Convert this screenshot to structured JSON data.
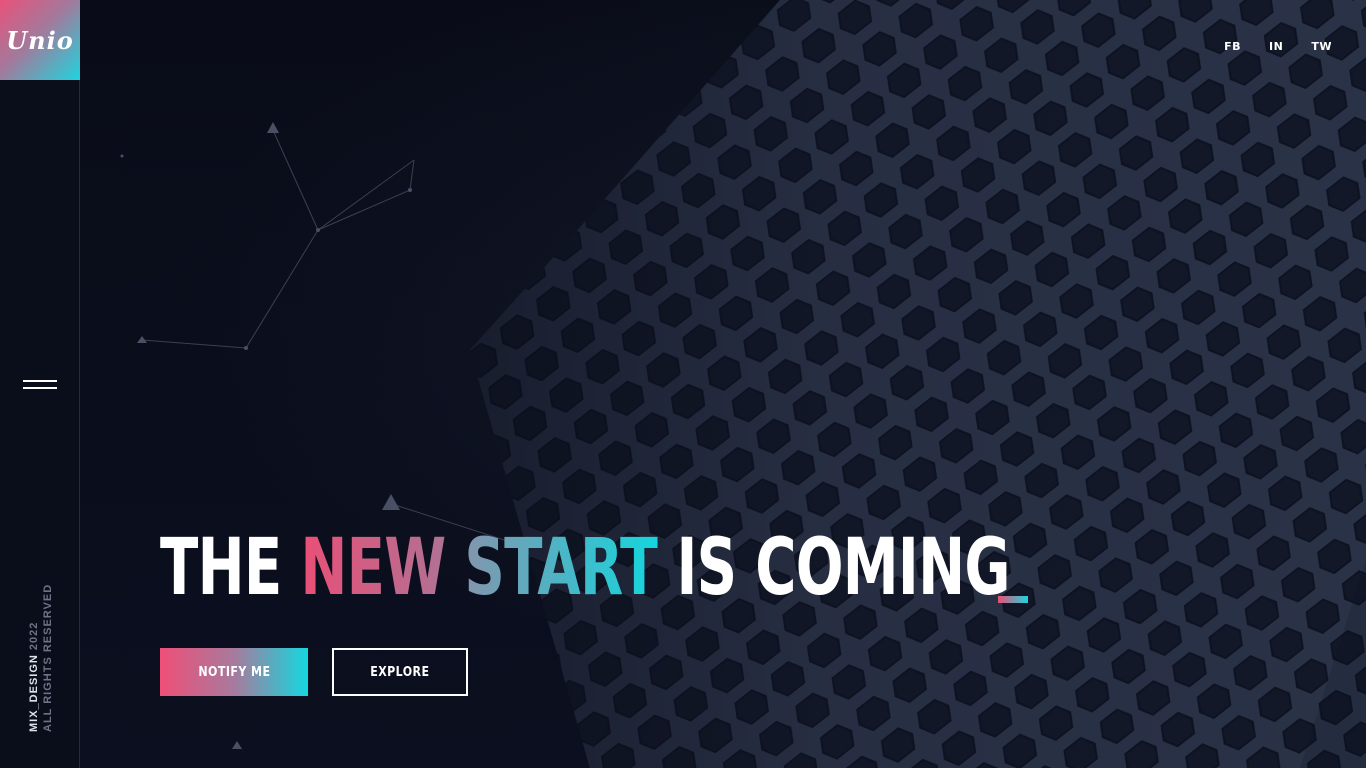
{
  "brand": {
    "logo_text": "Unio",
    "copyright_brand": "MIX_DESIGN",
    "copyright_year": "2022",
    "copyright_rights": "ALL RIGHTS RESERVED"
  },
  "social": [
    {
      "label": "FB"
    },
    {
      "label": "IN"
    },
    {
      "label": "TW"
    }
  ],
  "hero": {
    "headline": {
      "word1": "THE",
      "word2": "NEW",
      "word3": "START",
      "word4": "IS COMING"
    },
    "notify_label": "NOTIFY ME",
    "explore_label": "EXPLORE"
  },
  "icons": {
    "menu": "hamburger-menu-icon"
  },
  "colors": {
    "background": "#0a0d1a",
    "accent_pink": "#ea4f76",
    "accent_cyan": "#1fd4de",
    "text": "#ffffff"
  }
}
